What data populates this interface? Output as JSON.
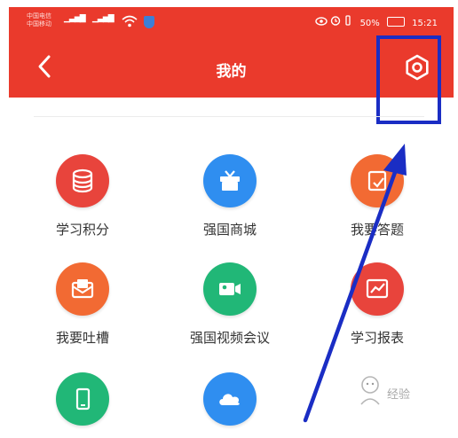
{
  "status_bar": {
    "carrier_1": "中国电信",
    "carrier_2": "中国移动",
    "right_text": "50%",
    "time": "15:21"
  },
  "header": {
    "title": "我的"
  },
  "grid": {
    "items": [
      {
        "label": "学习积分",
        "color": "#e8443c",
        "icon": "database-icon"
      },
      {
        "label": "强国商城",
        "color": "#2f8ef0",
        "icon": "gift-icon"
      },
      {
        "label": "我要答题",
        "color": "#f26a33",
        "icon": "edit-icon"
      },
      {
        "label": "我要吐槽",
        "color": "#f26a33",
        "icon": "mail-icon"
      },
      {
        "label": "强国视频会议",
        "color": "#21b777",
        "icon": "video-camera-icon"
      },
      {
        "label": "学习报表",
        "color": "#e8443c",
        "icon": "chart-icon"
      },
      {
        "label": "",
        "color": "#21b777",
        "icon": "phone-icon"
      },
      {
        "label": "",
        "color": "#2f8ef0",
        "icon": "cloud-icon"
      }
    ]
  },
  "watermark": {
    "text": "经验"
  },
  "colors": {
    "header_bg": "#ea3a2c",
    "annotation": "#1a2dc4"
  }
}
